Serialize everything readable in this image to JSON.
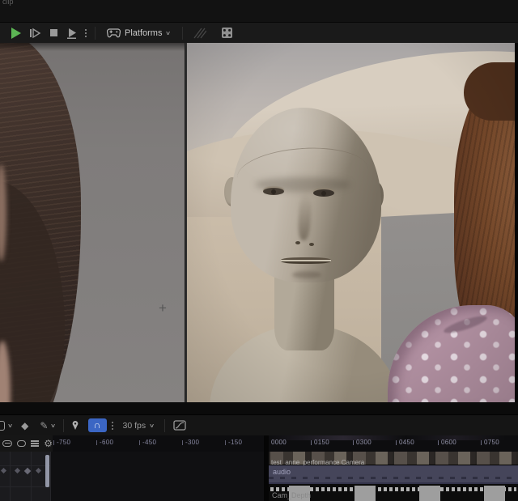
{
  "window": {
    "corner_label": "clip"
  },
  "top_toolbar": {
    "platforms_label": "Platforms",
    "icon_names": [
      "play",
      "step-forward",
      "stop",
      "play-from-start",
      "more-options",
      "gamepad",
      "multi-user-disabled",
      "device-grid"
    ]
  },
  "glyphs": {
    "kebab": "⋮",
    "chevron": "∨",
    "pencil": "✎",
    "gear": "⚙",
    "magnet": "∩",
    "diamond": "◆",
    "crosshair": "+"
  },
  "sequencer": {
    "fps_label": "30 fps",
    "icon_names": [
      "keyframe-diamond",
      "edit-pencil",
      "spawn-pin",
      "snap-magnet",
      "frame-rate",
      "curve-editor",
      "collapsed-track",
      "collapsed-track",
      "track-list",
      "settings-gear"
    ]
  },
  "timeline": {
    "left_ticks": [
      "-750",
      "-600",
      "-450",
      "-300",
      "-150"
    ],
    "right_ticks": [
      "0000",
      "0150",
      "0300",
      "0450",
      "0600",
      "0750"
    ],
    "clip_label": "test_anne_performance Camera",
    "audio_label": "audio",
    "depth_track_label": "Cam_Depth"
  },
  "colors": {
    "accent_blue": "#3b66c4",
    "play_green": "#5cb554",
    "playhead_green": "#3a9e4a",
    "audio_track": "#45455a",
    "viewport_backdrop_gray": "#7f7c7b",
    "sand": "#cfc6b9"
  }
}
